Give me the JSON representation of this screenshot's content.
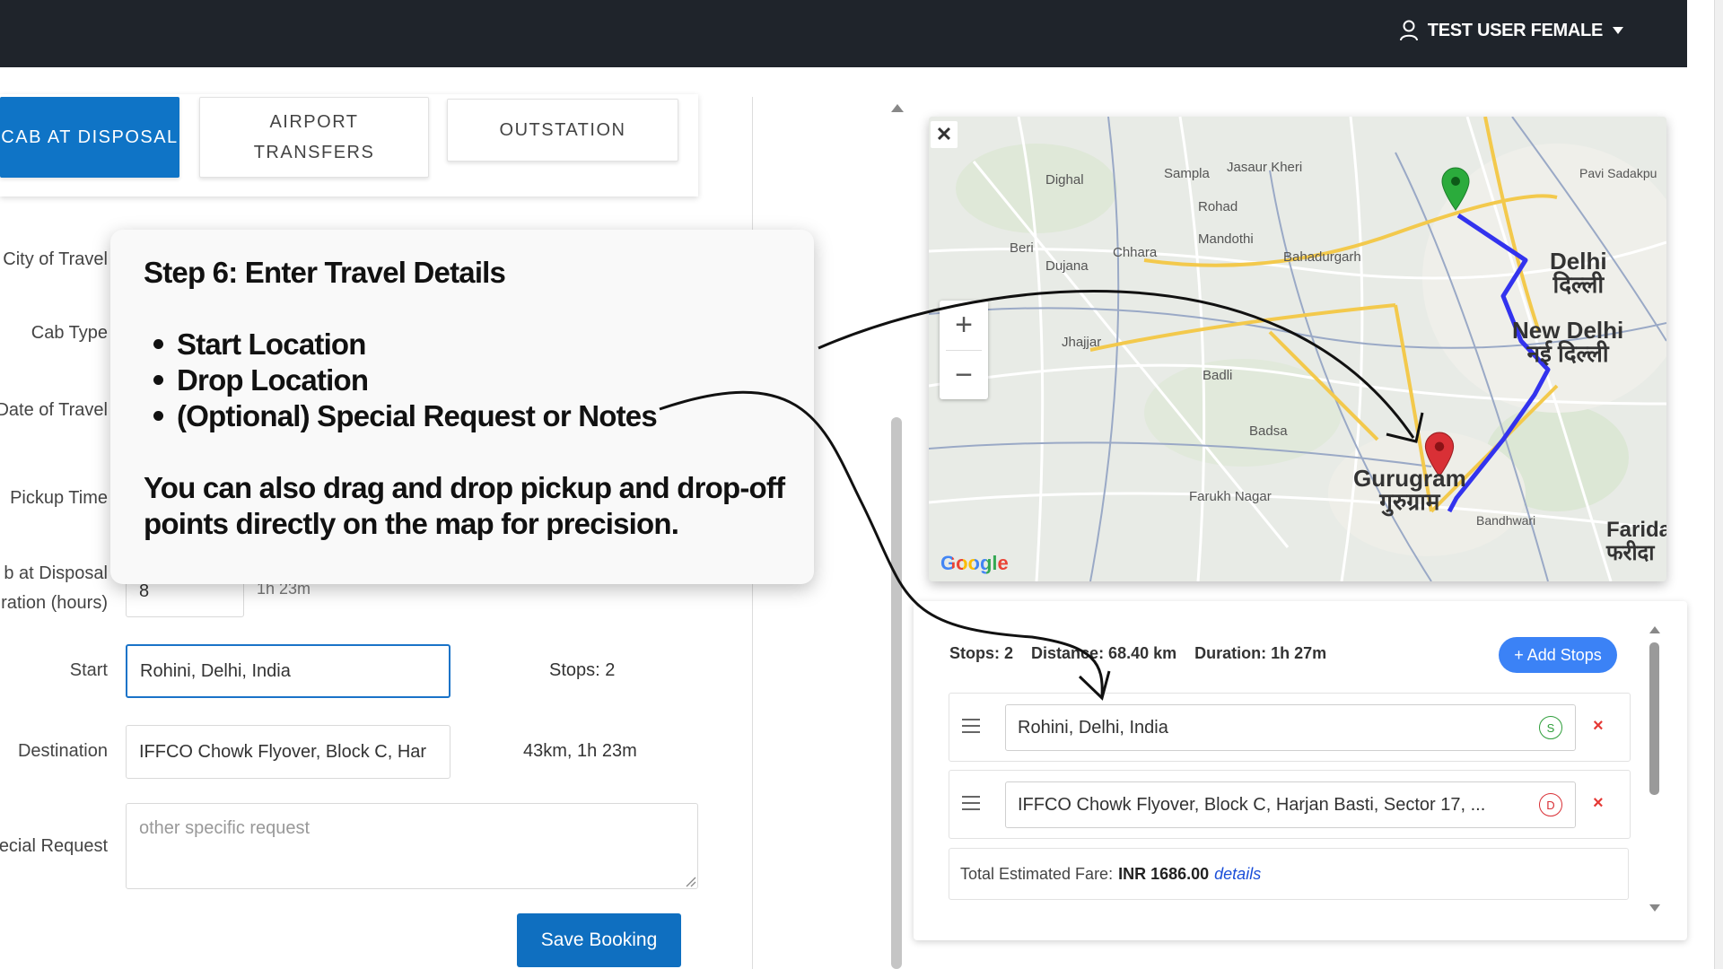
{
  "header": {
    "user_name": "TEST USER FEMALE"
  },
  "tabs": [
    {
      "label": "CAB AT DISPOSAL",
      "active": true
    },
    {
      "label": "AIRPORT TRANSFERS",
      "active": false
    },
    {
      "label": "OUTSTATION",
      "active": false
    }
  ],
  "form": {
    "labels": {
      "city": "City of Travel",
      "cab_type": "Cab Type",
      "date": "Date of Travel",
      "pickup_time": "Pickup Time",
      "disposal_line1": "b at Disposal",
      "disposal_line2": "ration (hours)",
      "start": "Start",
      "destination": "Destination",
      "special_request": "ecial Request"
    },
    "duration_value": "8",
    "duration_note": "1h 23m",
    "start_value": "Rohini, Delhi, India",
    "stops_note": "Stops: 2",
    "destination_value": "IFFCO Chowk Flyover, Block C, Har",
    "distance_note": "43km, 1h 23m",
    "special_request_placeholder": "other specific request",
    "save_label": "Save Booking"
  },
  "map": {
    "close_label": "✕",
    "zoom_in": "+",
    "zoom_out": "−",
    "attribution": "Google",
    "places": {
      "delhi": "Delhi",
      "delhi_hi": "दिल्ली",
      "new_delhi": "New Delhi",
      "new_delhi_hi": "नई दिल्ली",
      "gurugram": "Gurugram",
      "gurugram_hi": "गुरुग्राम",
      "faridabad": "Farida",
      "faridabad_hi": "फरीदा",
      "dighal": "Dighal",
      "sampla": "Sampla",
      "jasaur": "Jasaur Kheri",
      "rohad": "Rohad",
      "mandothi": "Mandothi",
      "bahadurgarh": "Bahadurgarh",
      "beri": "Beri",
      "dujana": "Dujana",
      "chhara": "Chhara",
      "jhajjar": "Jhajjar",
      "badli": "Badli",
      "badsa": "Badsa",
      "farukh": "Farukh Nagar",
      "bandhwari": "Bandhwari",
      "pavi": "Pavi Sadakpu"
    }
  },
  "stops_panel": {
    "stops": "Stops: 2",
    "distance": "Distance: 68.40 km",
    "duration": "Duration: 1h 27m",
    "add_stops_label": "+ Add Stops",
    "rows": [
      {
        "value": "Rohini, Delhi, India",
        "badge": "S"
      },
      {
        "value": "IFFCO Chowk Flyover, Block C, Harjan Basti, Sector 17, ...",
        "badge": "D"
      }
    ],
    "remove_label": "×",
    "fare_label": "Total Estimated Fare:",
    "fare_value": "INR 1686.00",
    "details_link": "details"
  },
  "callout": {
    "title": "Step 6: Enter Travel Details",
    "bullets": [
      "Start Location",
      "Drop Location",
      "(Optional) Special Request or Notes"
    ],
    "body": "You can also drag and drop pickup and drop-off points directly on the map for precision."
  },
  "colors": {
    "topbar": "#1f242b",
    "primary": "#0f74c6",
    "route": "#3333ee",
    "start_marker": "#2bab3c",
    "end_marker": "#d93036"
  }
}
